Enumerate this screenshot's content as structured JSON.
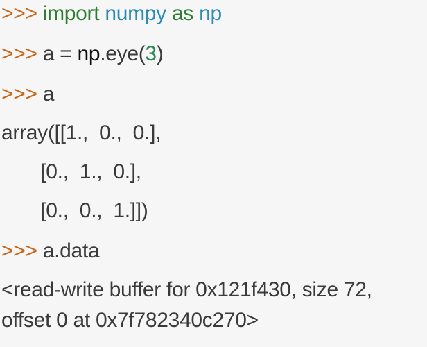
{
  "console": {
    "prompt": ">>>",
    "colors": {
      "background": "#f6f6f6",
      "prompt": "#c8671a",
      "keyword": "#2e7d32",
      "module": "#2a8bb4",
      "number": "#2e8b57",
      "text": "#3a3a3a"
    },
    "line1": {
      "import_kw": "import",
      "module": "numpy",
      "as_kw": "as",
      "alias": "np"
    },
    "line2": {
      "var": "a",
      "eq": "=",
      "obj": "np",
      "call": ".eye(",
      "arg": "3",
      "close": ")"
    },
    "line3": {
      "expr": "a"
    },
    "output": {
      "row1": "array([[1.,  0.,  0.],",
      "row2": "       [0.,  1.,  0.],",
      "row3": "       [0.,  0.,  1.]])"
    },
    "line4": {
      "expr": "a.data"
    },
    "result": {
      "line1": "<read-write buffer for 0x121f430, size 72,",
      "line2": "offset 0 at 0x7f782340c270>"
    }
  }
}
